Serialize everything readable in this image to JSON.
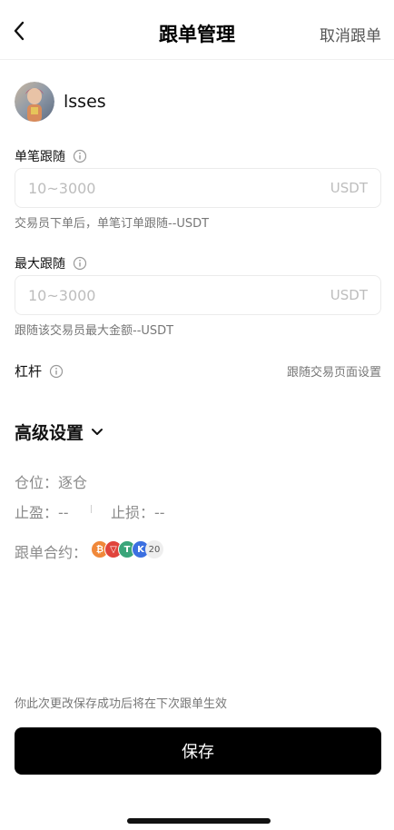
{
  "header": {
    "title": "跟单管理",
    "cancel_label": "取消跟单",
    "back_icon": "chevron-left-icon"
  },
  "profile": {
    "username": "lsses"
  },
  "single_follow": {
    "label": "单笔跟随",
    "placeholder": "10~3000",
    "value": "",
    "unit": "USDT",
    "hint": "交易员下单后，单笔订单跟随--USDT"
  },
  "max_follow": {
    "label": "最大跟随",
    "placeholder": "10~3000",
    "value": "",
    "unit": "USDT",
    "hint": "跟随该交易员最大金额--USDT"
  },
  "leverage": {
    "label": "杠杆",
    "link": "跟随交易页面设置"
  },
  "advanced": {
    "title": "高级设置",
    "position_mode": "仓位：逐仓",
    "take_profit": "止盈：--",
    "stop_loss": "止损：--",
    "contracts_label": "跟单合约：",
    "contracts_more": "20",
    "coins": [
      {
        "icon": "btc-coin-icon",
        "glyph": "₿",
        "color": "#f0883a"
      },
      {
        "icon": "trx-coin-icon",
        "glyph": "▽",
        "color": "#e0443c"
      },
      {
        "icon": "usdt-coin-icon",
        "glyph": "T",
        "color": "#3aa57a"
      },
      {
        "icon": "kcs-coin-icon",
        "glyph": "K",
        "color": "#3b6fe0"
      }
    ]
  },
  "footer": {
    "notice": "你此次更改保存成功后将在下次跟单生效",
    "save_label": "保存"
  }
}
